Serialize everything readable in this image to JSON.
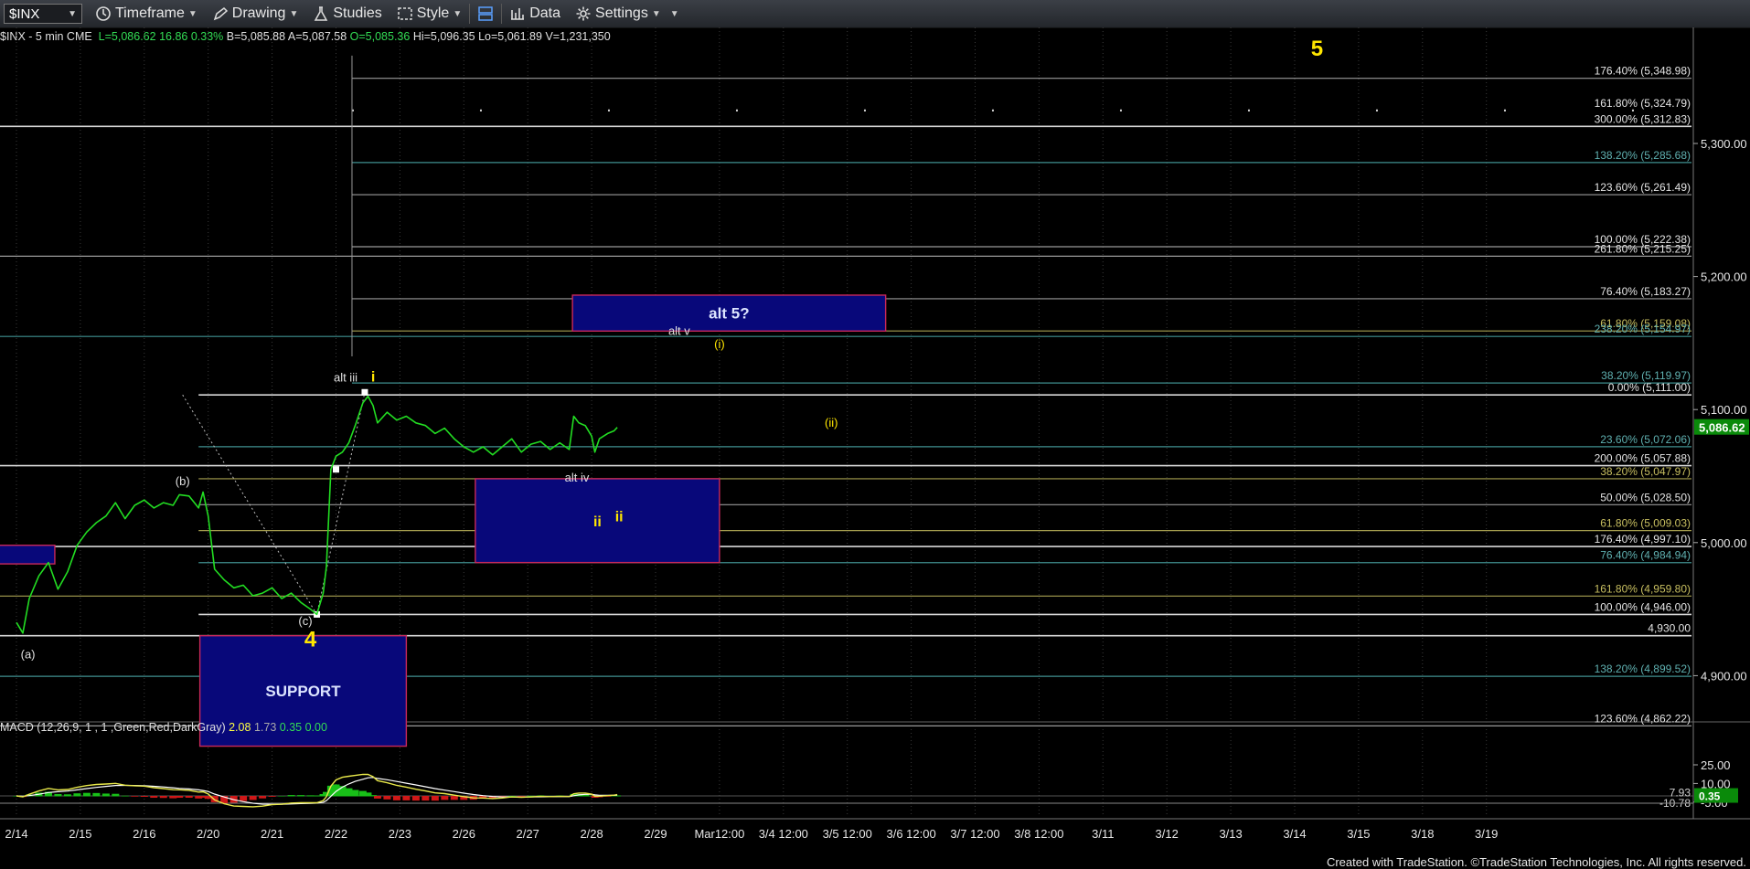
{
  "toolbar": {
    "symbol": "$INX",
    "timeframe": "Timeframe",
    "drawing": "Drawing",
    "studies": "Studies",
    "style": "Style",
    "data": "Data",
    "settings": "Settings"
  },
  "status": {
    "prefix": "$INX - 5 min  CME",
    "last": "L=5,086.62",
    "change": "16.86",
    "pct": "0.33%",
    "bid": "B=5,085.88",
    "ask": "A=5,087.58",
    "open": "O=5,085.36",
    "high": "Hi=5,096.35",
    "low": "Lo=5,061.89",
    "vol": "V=1,231,350"
  },
  "macd_status": {
    "label": "MACD (12,26,9, 1 , 1 ,Green,Red,DarkGray)",
    "v1": "2.08",
    "v2": "1.73",
    "v3": "0.35",
    "v4": "0.00"
  },
  "footer": "Created with TradeStation. ©TradeStation Technologies, Inc. All rights reserved.",
  "colors": {
    "price": "#22dd22",
    "white_line": "#d8d8d8",
    "teal": "#3f8f8f",
    "olive": "#a7a050",
    "box": "#08087a",
    "box_border": "#c8285a",
    "yellow": "#ffe600",
    "macd": "#e8e84a",
    "signal": "#ffffff"
  },
  "chart_data": {
    "type": "line",
    "x_labels": [
      "2/14",
      "2/15",
      "2/16",
      "2/20",
      "2/21",
      "2/22",
      "2/23",
      "2/26",
      "2/27",
      "2/28",
      "2/29",
      "Mar12:00",
      "3/4 12:00",
      "3/5 12:00",
      "3/6 12:00",
      "3/7 12:00",
      "3/8 12:00",
      "3/11",
      "3/12",
      "3/13",
      "3/14",
      "3/15",
      "3/18",
      "3/19"
    ],
    "y_ticks": [
      "5,300.00",
      "5,200.00",
      "5,100.00",
      "5,000.00",
      "4,900.00"
    ],
    "y_tick_values": [
      5300,
      5200,
      5100,
      5000,
      4900
    ],
    "last_price_label": "5,086.62",
    "last_price": 5086.62,
    "price_series": [
      [
        0.0,
        4940
      ],
      [
        0.1,
        4932
      ],
      [
        0.2,
        4958
      ],
      [
        0.35,
        4975
      ],
      [
        0.5,
        4985
      ],
      [
        0.65,
        4965
      ],
      [
        0.8,
        4978
      ],
      [
        0.95,
        4998
      ],
      [
        1.1,
        5008
      ],
      [
        1.25,
        5015
      ],
      [
        1.4,
        5020
      ],
      [
        1.55,
        5030
      ],
      [
        1.7,
        5018
      ],
      [
        1.85,
        5028
      ],
      [
        2.0,
        5032
      ],
      [
        2.15,
        5026
      ],
      [
        2.3,
        5030
      ],
      [
        2.45,
        5028
      ],
      [
        2.55,
        5036
      ],
      [
        2.7,
        5035
      ],
      [
        2.85,
        5026
      ],
      [
        2.92,
        5038
      ],
      [
        3.0,
        5020
      ],
      [
        3.1,
        4980
      ],
      [
        3.25,
        4972
      ],
      [
        3.4,
        4966
      ],
      [
        3.55,
        4968
      ],
      [
        3.7,
        4960
      ],
      [
        3.85,
        4962
      ],
      [
        4.0,
        4966
      ],
      [
        4.15,
        4958
      ],
      [
        4.3,
        4962
      ],
      [
        4.45,
        4955
      ],
      [
        4.6,
        4950
      ],
      [
        4.7,
        4946
      ],
      [
        4.8,
        4962
      ],
      [
        4.85,
        4982
      ],
      [
        4.92,
        5055
      ],
      [
        5.0,
        5065
      ],
      [
        5.1,
        5068
      ],
      [
        5.2,
        5075
      ],
      [
        5.3,
        5088
      ],
      [
        5.42,
        5105
      ],
      [
        5.5,
        5110
      ],
      [
        5.58,
        5103
      ],
      [
        5.65,
        5090
      ],
      [
        5.8,
        5098
      ],
      [
        5.95,
        5092
      ],
      [
        6.1,
        5095
      ],
      [
        6.25,
        5090
      ],
      [
        6.4,
        5088
      ],
      [
        6.55,
        5082
      ],
      [
        6.7,
        5086
      ],
      [
        6.85,
        5078
      ],
      [
        7.0,
        5072
      ],
      [
        7.15,
        5068
      ],
      [
        7.3,
        5072
      ],
      [
        7.45,
        5066
      ],
      [
        7.6,
        5072
      ],
      [
        7.75,
        5078
      ],
      [
        7.9,
        5068
      ],
      [
        8.05,
        5074
      ],
      [
        8.2,
        5076
      ],
      [
        8.35,
        5070
      ],
      [
        8.5,
        5075
      ],
      [
        8.65,
        5070
      ],
      [
        8.72,
        5095
      ],
      [
        8.8,
        5090
      ],
      [
        8.9,
        5088
      ],
      [
        9.0,
        5080
      ],
      [
        9.05,
        5068
      ],
      [
        9.12,
        5078
      ],
      [
        9.25,
        5082
      ],
      [
        9.35,
        5084
      ],
      [
        9.4,
        5086.62
      ]
    ],
    "levels": [
      {
        "label": "176.40% (5,348.98)",
        "value": 5348.98,
        "kind": "gray",
        "start": 5.25
      },
      {
        "label": "161.80% (5,324.79)",
        "value": 5324.79,
        "kind": "dotted",
        "start": 5.25
      },
      {
        "label": "300.00% (5,312.83)",
        "value": 5312.83,
        "kind": "white",
        "start": 0
      },
      {
        "label": "138.20% (5,285.68)",
        "value": 5285.68,
        "kind": "teal",
        "start": 5.25
      },
      {
        "label": "123.60% (5,261.49)",
        "value": 5261.49,
        "kind": "gray",
        "start": 5.25
      },
      {
        "label": "100.00% (5,222.38)",
        "value": 5222.38,
        "kind": "gray",
        "start": 5.25
      },
      {
        "label": "261.80% (5,215.25)",
        "value": 5215.25,
        "kind": "gray",
        "start": 0
      },
      {
        "label": "76.40% (5,183.27)",
        "value": 5183.27,
        "kind": "gray",
        "start": 5.25
      },
      {
        "label": "61.80% (5,159.08)",
        "value": 5159.08,
        "kind": "olive",
        "start": 5.25
      },
      {
        "label": "238.20% (5,154.97)",
        "value": 5154.97,
        "kind": "teal",
        "start": 0
      },
      {
        "label": "38.20% (5,119.97)",
        "value": 5119.97,
        "kind": "teal",
        "start": 5.25
      },
      {
        "label": "0.00% (5,111.00)",
        "value": 5111.0,
        "kind": "white",
        "start": 2.85
      },
      {
        "label": "23.60% (5,072.06)",
        "value": 5072.06,
        "kind": "teal",
        "start": 2.85
      },
      {
        "label": "200.00% (5,057.88)",
        "value": 5057.88,
        "kind": "white",
        "start": 0
      },
      {
        "label": "38.20% (5,047.97)",
        "value": 5047.97,
        "kind": "olive",
        "start": 2.85
      },
      {
        "label": "50.00% (5,028.50)",
        "value": 5028.5,
        "kind": "gray",
        "start": 2.85
      },
      {
        "label": "61.80% (5,009.03)",
        "value": 5009.03,
        "kind": "olive",
        "start": 2.85
      },
      {
        "label": "176.40% (4,997.10)",
        "value": 4997.1,
        "kind": "white",
        "start": 0
      },
      {
        "label": "76.40% (4,984.94)",
        "value": 4984.94,
        "kind": "teal",
        "start": 2.85
      },
      {
        "label": "161.80% (4,959.80)",
        "value": 4959.8,
        "kind": "olive",
        "start": 0
      },
      {
        "label": "100.00% (4,946.00)",
        "value": 4946.0,
        "kind": "white",
        "start": 2.85
      },
      {
        "label": "4,930.00",
        "value": 4930.0,
        "kind": "white",
        "start": 0
      },
      {
        "label": "138.20% (4,899.52)",
        "value": 4899.52,
        "kind": "teal",
        "start": 0
      },
      {
        "label": "123.60% (4,862.22)",
        "value": 4862.22,
        "kind": "gray",
        "start": 0
      }
    ],
    "boxes": [
      {
        "label": "alt 5?",
        "x0": 8.7,
        "x1": 13.6,
        "y0": 5159,
        "y1": 5186
      },
      {
        "label": "ii",
        "x0": 7.18,
        "x1": 11.0,
        "y0": 4985,
        "y1": 5048
      },
      {
        "label": "SUPPORT",
        "x0": 2.87,
        "x1": 6.1,
        "y0": 4847,
        "y1": 4930
      },
      {
        "label": "",
        "x0": -0.5,
        "x1": 0.6,
        "y0": 4984,
        "y1": 4998
      }
    ],
    "annotations": [
      {
        "text": "5",
        "x": 20.35,
        "y": 5366,
        "color": "yellow",
        "size": "big"
      },
      {
        "text": "4",
        "x": 4.6,
        "y": 4922,
        "color": "yellow",
        "size": "big"
      },
      {
        "text": "i",
        "x": 5.58,
        "y": 5121,
        "color": "yellow",
        "size": "small"
      },
      {
        "text": "ii",
        "x": 9.43,
        "y": 5016,
        "color": "yellow",
        "size": "small"
      },
      {
        "text": "(i)",
        "x": 11.0,
        "y": 5146,
        "color": "yellow",
        "size": "tiny"
      },
      {
        "text": "(ii)",
        "x": 12.75,
        "y": 5087,
        "color": "yellow",
        "size": "tiny"
      },
      {
        "text": "alt iii",
        "x": 5.15,
        "y": 5121,
        "color": "white",
        "size": "tiny"
      },
      {
        "text": "alt v",
        "x": 10.37,
        "y": 5156,
        "color": "white",
        "size": "tiny"
      },
      {
        "text": "alt iv",
        "x": 8.77,
        "y": 5046,
        "color": "white",
        "size": "tiny"
      },
      {
        "text": "(b)",
        "x": 2.6,
        "y": 5043,
        "color": "white",
        "size": "tiny"
      },
      {
        "text": "(c)",
        "x": 4.52,
        "y": 4938,
        "color": "white",
        "size": "tiny"
      },
      {
        "text": "(a)",
        "x": 0.18,
        "y": 4913,
        "color": "white",
        "size": "tiny"
      }
    ],
    "macd": {
      "y_ticks": [
        "25.00",
        "10.00",
        "-5.00"
      ],
      "y_tick_values": [
        25,
        10,
        -5
      ],
      "right_labels": [
        {
          "text": "7.93",
          "value": 2.6
        },
        {
          "text": "-10.78",
          "value": -5.9
        }
      ],
      "current_label": "0.35",
      "current": 0.35,
      "ylim": [
        -12,
        30
      ]
    }
  }
}
